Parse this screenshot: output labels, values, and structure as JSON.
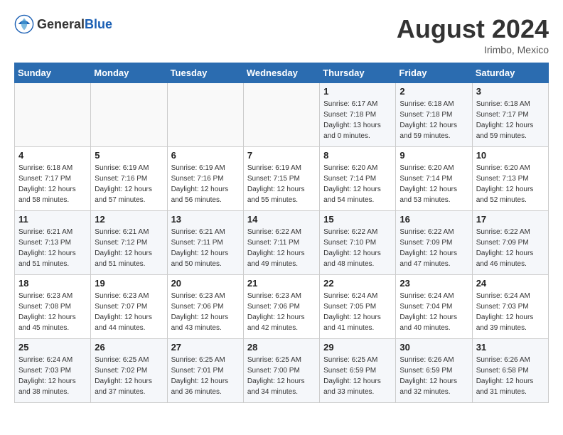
{
  "header": {
    "logo_general": "General",
    "logo_blue": "Blue",
    "month_title": "August 2024",
    "location": "Irimbo, Mexico"
  },
  "days_of_week": [
    "Sunday",
    "Monday",
    "Tuesday",
    "Wednesday",
    "Thursday",
    "Friday",
    "Saturday"
  ],
  "weeks": [
    [
      {
        "day": "",
        "info": ""
      },
      {
        "day": "",
        "info": ""
      },
      {
        "day": "",
        "info": ""
      },
      {
        "day": "",
        "info": ""
      },
      {
        "day": "1",
        "sunrise": "6:17 AM",
        "sunset": "7:18 PM",
        "daylight": "13 hours and 0 minutes."
      },
      {
        "day": "2",
        "sunrise": "6:18 AM",
        "sunset": "7:18 PM",
        "daylight": "12 hours and 59 minutes."
      },
      {
        "day": "3",
        "sunrise": "6:18 AM",
        "sunset": "7:17 PM",
        "daylight": "12 hours and 59 minutes."
      }
    ],
    [
      {
        "day": "4",
        "sunrise": "6:18 AM",
        "sunset": "7:17 PM",
        "daylight": "12 hours and 58 minutes."
      },
      {
        "day": "5",
        "sunrise": "6:19 AM",
        "sunset": "7:16 PM",
        "daylight": "12 hours and 57 minutes."
      },
      {
        "day": "6",
        "sunrise": "6:19 AM",
        "sunset": "7:16 PM",
        "daylight": "12 hours and 56 minutes."
      },
      {
        "day": "7",
        "sunrise": "6:19 AM",
        "sunset": "7:15 PM",
        "daylight": "12 hours and 55 minutes."
      },
      {
        "day": "8",
        "sunrise": "6:20 AM",
        "sunset": "7:14 PM",
        "daylight": "12 hours and 54 minutes."
      },
      {
        "day": "9",
        "sunrise": "6:20 AM",
        "sunset": "7:14 PM",
        "daylight": "12 hours and 53 minutes."
      },
      {
        "day": "10",
        "sunrise": "6:20 AM",
        "sunset": "7:13 PM",
        "daylight": "12 hours and 52 minutes."
      }
    ],
    [
      {
        "day": "11",
        "sunrise": "6:21 AM",
        "sunset": "7:13 PM",
        "daylight": "12 hours and 51 minutes."
      },
      {
        "day": "12",
        "sunrise": "6:21 AM",
        "sunset": "7:12 PM",
        "daylight": "12 hours and 51 minutes."
      },
      {
        "day": "13",
        "sunrise": "6:21 AM",
        "sunset": "7:11 PM",
        "daylight": "12 hours and 50 minutes."
      },
      {
        "day": "14",
        "sunrise": "6:22 AM",
        "sunset": "7:11 PM",
        "daylight": "12 hours and 49 minutes."
      },
      {
        "day": "15",
        "sunrise": "6:22 AM",
        "sunset": "7:10 PM",
        "daylight": "12 hours and 48 minutes."
      },
      {
        "day": "16",
        "sunrise": "6:22 AM",
        "sunset": "7:09 PM",
        "daylight": "12 hours and 47 minutes."
      },
      {
        "day": "17",
        "sunrise": "6:22 AM",
        "sunset": "7:09 PM",
        "daylight": "12 hours and 46 minutes."
      }
    ],
    [
      {
        "day": "18",
        "sunrise": "6:23 AM",
        "sunset": "7:08 PM",
        "daylight": "12 hours and 45 minutes."
      },
      {
        "day": "19",
        "sunrise": "6:23 AM",
        "sunset": "7:07 PM",
        "daylight": "12 hours and 44 minutes."
      },
      {
        "day": "20",
        "sunrise": "6:23 AM",
        "sunset": "7:06 PM",
        "daylight": "12 hours and 43 minutes."
      },
      {
        "day": "21",
        "sunrise": "6:23 AM",
        "sunset": "7:06 PM",
        "daylight": "12 hours and 42 minutes."
      },
      {
        "day": "22",
        "sunrise": "6:24 AM",
        "sunset": "7:05 PM",
        "daylight": "12 hours and 41 minutes."
      },
      {
        "day": "23",
        "sunrise": "6:24 AM",
        "sunset": "7:04 PM",
        "daylight": "12 hours and 40 minutes."
      },
      {
        "day": "24",
        "sunrise": "6:24 AM",
        "sunset": "7:03 PM",
        "daylight": "12 hours and 39 minutes."
      }
    ],
    [
      {
        "day": "25",
        "sunrise": "6:24 AM",
        "sunset": "7:03 PM",
        "daylight": "12 hours and 38 minutes."
      },
      {
        "day": "26",
        "sunrise": "6:25 AM",
        "sunset": "7:02 PM",
        "daylight": "12 hours and 37 minutes."
      },
      {
        "day": "27",
        "sunrise": "6:25 AM",
        "sunset": "7:01 PM",
        "daylight": "12 hours and 36 minutes."
      },
      {
        "day": "28",
        "sunrise": "6:25 AM",
        "sunset": "7:00 PM",
        "daylight": "12 hours and 34 minutes."
      },
      {
        "day": "29",
        "sunrise": "6:25 AM",
        "sunset": "6:59 PM",
        "daylight": "12 hours and 33 minutes."
      },
      {
        "day": "30",
        "sunrise": "6:26 AM",
        "sunset": "6:59 PM",
        "daylight": "12 hours and 32 minutes."
      },
      {
        "day": "31",
        "sunrise": "6:26 AM",
        "sunset": "6:58 PM",
        "daylight": "12 hours and 31 minutes."
      }
    ]
  ]
}
